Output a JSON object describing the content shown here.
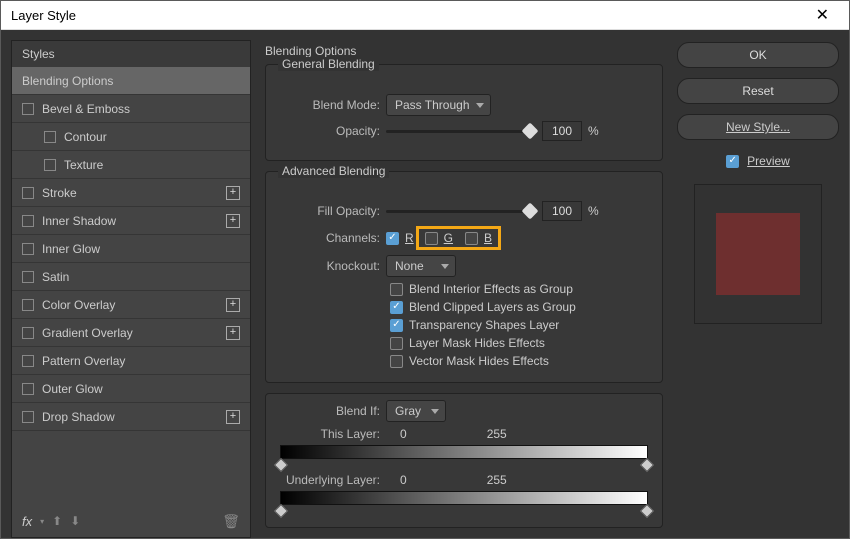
{
  "window": {
    "title": "Layer Style"
  },
  "sidebar": {
    "header": "Styles",
    "items": [
      {
        "label": "Blending Options",
        "selected": true,
        "check": false,
        "plus": false
      },
      {
        "label": "Bevel & Emboss",
        "check": true,
        "plus": false
      },
      {
        "label": "Contour",
        "check": true,
        "plus": false,
        "child": true
      },
      {
        "label": "Texture",
        "check": true,
        "plus": false,
        "child": true
      },
      {
        "label": "Stroke",
        "check": true,
        "plus": true
      },
      {
        "label": "Inner Shadow",
        "check": true,
        "plus": true
      },
      {
        "label": "Inner Glow",
        "check": true,
        "plus": false
      },
      {
        "label": "Satin",
        "check": true,
        "plus": false
      },
      {
        "label": "Color Overlay",
        "check": true,
        "plus": true
      },
      {
        "label": "Gradient Overlay",
        "check": true,
        "plus": true
      },
      {
        "label": "Pattern Overlay",
        "check": true,
        "plus": false
      },
      {
        "label": "Outer Glow",
        "check": true,
        "plus": false
      },
      {
        "label": "Drop Shadow",
        "check": true,
        "plus": true
      }
    ],
    "footer_fx": "fx"
  },
  "main": {
    "title": "Blending Options",
    "general": {
      "legend": "General Blending",
      "blend_mode_label": "Blend Mode:",
      "blend_mode": "Pass Through",
      "opacity_label": "Opacity:",
      "opacity_value": "100",
      "percent": "%"
    },
    "advanced": {
      "legend": "Advanced Blending",
      "fill_opacity_label": "Fill Opacity:",
      "fill_opacity_value": "100",
      "percent": "%",
      "channels_label": "Channels:",
      "ch_r": "R",
      "ch_g": "G",
      "ch_b": "B",
      "knockout_label": "Knockout:",
      "knockout": "None",
      "opts": {
        "interior": "Blend Interior Effects as Group",
        "clipped": "Blend Clipped Layers as Group",
        "transparency": "Transparency Shapes Layer",
        "layermask": "Layer Mask Hides Effects",
        "vectormask": "Vector Mask Hides Effects"
      }
    },
    "blendif": {
      "label": "Blend If:",
      "mode": "Gray",
      "this_layer": "This Layer:",
      "this_lo": "0",
      "this_hi": "255",
      "under_layer": "Underlying Layer:",
      "under_lo": "0",
      "under_hi": "255"
    }
  },
  "right": {
    "ok": "OK",
    "reset": "Reset",
    "new_style": "New Style...",
    "preview": "Preview"
  }
}
